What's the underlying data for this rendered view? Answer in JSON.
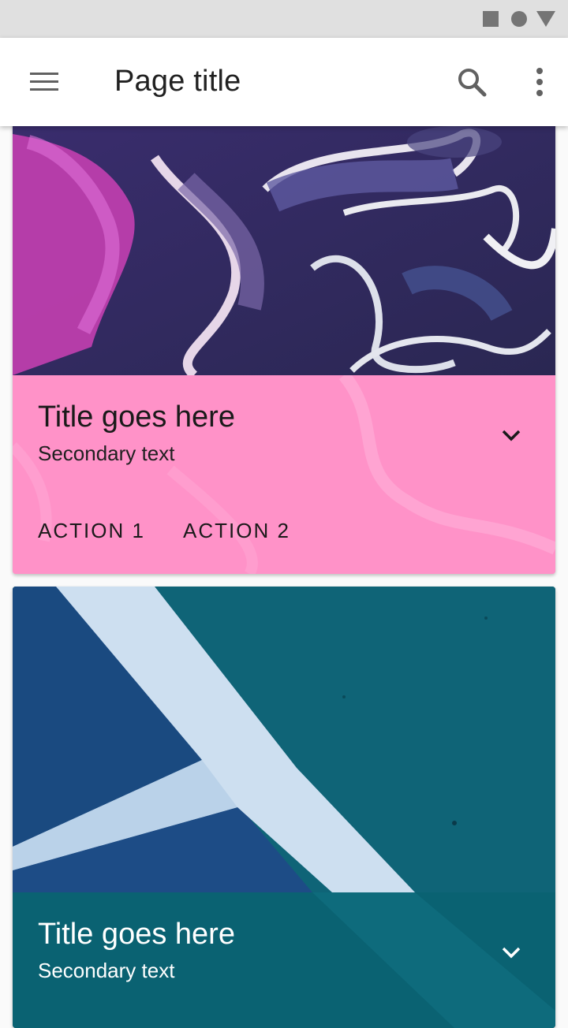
{
  "status_bar": {
    "icons": [
      "stop-square-icon",
      "circle-icon",
      "triangle-down-icon"
    ]
  },
  "app_bar": {
    "title": "Page title",
    "icons": [
      "menu-icon",
      "search-icon",
      "more-vert-icon"
    ]
  },
  "cards": [
    {
      "title": "Title goes here",
      "secondary": "Secondary text",
      "actions": [
        "ACTION 1",
        "ACTION 2"
      ],
      "expand_icon": "chevron-down-icon",
      "colors": {
        "content_bg": "#ff92c8"
      }
    },
    {
      "title": "Title goes here",
      "secondary": "Secondary text",
      "expand_icon": "chevron-down-icon",
      "colors": {
        "content_bg": "#0a6272"
      }
    }
  ]
}
